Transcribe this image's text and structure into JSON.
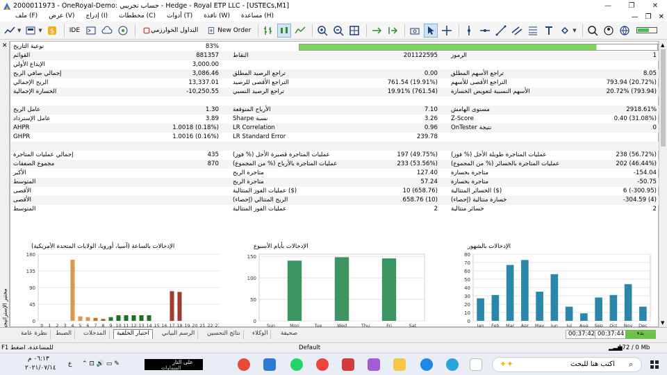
{
  "window": {
    "title": "2000011973 - OneRoyal-Demo: حساب تجريبي - Hedge - Royal ETP LLC - [USTECs,M1]"
  },
  "menu": [
    {
      "id": "file",
      "label": "ملف (F)"
    },
    {
      "id": "view",
      "label": "عرض (V)"
    },
    {
      "id": "insert",
      "label": "إدراج (I)"
    },
    {
      "id": "charts",
      "label": "مخططات (C)"
    },
    {
      "id": "tools",
      "label": "أدوات (T)"
    },
    {
      "id": "window",
      "label": "نافذة (W)"
    },
    {
      "id": "help",
      "label": "مساعدة (H)"
    }
  ],
  "toolbar": {
    "ide": "IDE",
    "algo_trading": "التداول الخوارزمي",
    "new_order": "New Order"
  },
  "report": {
    "history_quality_label": "نوعية التاريخ",
    "history_quality_value": "83%",
    "history_quality_fraction": 0.83,
    "rows": [
      {
        "a_label": "القوائم",
        "a_value": "881357",
        "b_label": "النقاط",
        "b_value": "201122595",
        "c_label": "الرموز",
        "c_value": "1"
      },
      {
        "a_label": "الإيداع الأولي",
        "a_value": "3,000.00",
        "b_label": "",
        "b_value": "",
        "c_label": "",
        "c_value": ""
      },
      {
        "a_label": "إجمالي صافي الربح",
        "a_value": "3,086.46",
        "b_label": "تراجع الرصيد المطلق",
        "b_value": "0.00",
        "c_label": "تراجع الأسهم المطلق",
        "c_value": "8.05"
      },
      {
        "a_label": "الربح الإجمالي",
        "a_value": "13,337.01",
        "b_label": "التراجع الأقصى للرصيد",
        "b_value": "761.54 (19.91%)",
        "c_label": "التراجع الأقصى للأسهم",
        "c_value": "793.94 (20.72%)"
      },
      {
        "a_label": "الخسارة الإجمالية",
        "a_value": "-10,250.55",
        "b_label": "تراجع الرصيد النسبي",
        "b_value": "19.91% (761.54)",
        "c_label": "الأسهم النسبية لتعويض الخسارة",
        "c_value": "20.72% (793.94)"
      },
      {
        "a_label": "",
        "a_value": "",
        "b_label": "",
        "b_value": "",
        "c_label": "",
        "c_value": ""
      },
      {
        "a_label": "عامل الربح",
        "a_value": "1.30",
        "b_label": "الأرباح المتوقعة",
        "b_value": "7.10",
        "c_label": "مستوى الهامش",
        "c_value": "2918.61%"
      },
      {
        "a_label": "عامل الإسترداد",
        "a_value": "3.89",
        "b_label": "Sharpe نسبة",
        "b_value": "3.26",
        "c_label": "Z-Score",
        "c_value": "0.40 (31.08%)"
      },
      {
        "a_label": "AHPR",
        "a_value": "1.0018 (0.18%)",
        "b_label": "LR Correlation",
        "b_value": "0.96",
        "c_label": "OnTester نتيجة",
        "c_value": "0"
      },
      {
        "a_label": "GHPR",
        "a_value": "1.0016 (0.16%)",
        "b_label": "LR Standard Error",
        "b_value": "239.78",
        "c_label": "",
        "c_value": ""
      },
      {
        "a_label": "",
        "a_value": "",
        "b_label": "",
        "b_value": "",
        "c_label": "",
        "c_value": ""
      },
      {
        "a_label": "إجمالي عمليات المتاجرة",
        "a_value": "435",
        "b_label": "عمليات المتاجرة قصيرة الأجل (% فوز)",
        "b_value": "197 (49.75%)",
        "c_label": "عمليات المتاجرة طويلة الأجل (% فوز)",
        "c_value": "238 (56.72%)"
      },
      {
        "a_label": "مجموع الصفقات",
        "a_value": "870",
        "b_label": "عمليات المتاجرة بالأرباح (% من المجموع)",
        "b_value": "233 (53.56%)",
        "c_label": "عمليات المتاجرة بالخسائر (% من المجموع)",
        "c_value": "202 (46.44%)"
      },
      {
        "a_label": "الأكبر",
        "a_value": "",
        "b_label": "متاجرة الربح",
        "b_value": "127.40",
        "c_label": "متاجرة بخسارة",
        "c_value": "-154.04"
      },
      {
        "a_label": "المتوسط",
        "a_value": "",
        "b_label": "متاجرة الربح",
        "b_value": "57.24",
        "c_label": "متاجرة بخسارة",
        "c_value": "-50.75"
      },
      {
        "a_label": "الأقصى",
        "a_value": "",
        "b_label": "عمليات الفوز المتتالية ($)",
        "b_value": "10 (658.76)",
        "c_label": "الخسائر المتتالية ($)",
        "c_value": "6 (-300.95)"
      },
      {
        "a_label": "الأقصى",
        "a_value": "",
        "b_label": "الربح المتتالي (إحصاء)",
        "b_value": "658.76 (10)",
        "c_label": "خسارة متتالية (إحصاء)",
        "c_value": "-304.59 (4)"
      },
      {
        "a_label": "المتوسط",
        "a_value": "",
        "b_label": "عمليات الفوز المتتالية",
        "b_value": "2",
        "c_label": "خسائر متتالية",
        "c_value": "2"
      }
    ]
  },
  "chart_data": [
    {
      "type": "bar",
      "title": "الإدخالات بالساعة (آسيا، أوروبا، الولايات المتحدة الأمريكية)",
      "categories": [
        "0",
        "1",
        "2",
        "3",
        "4",
        "5",
        "6",
        "7",
        "8",
        "9",
        "10",
        "11",
        "12",
        "13",
        "14",
        "15",
        "16",
        "17",
        "18",
        "19",
        "20",
        "21",
        "22",
        "23"
      ],
      "values": [
        0,
        0,
        0,
        0,
        165,
        12,
        10,
        8,
        5,
        10,
        15,
        15,
        15,
        15,
        15,
        0,
        0,
        80,
        78,
        0,
        0,
        0,
        0,
        0
      ],
      "colors": [
        "#d99a4e",
        "#d99a4e",
        "#d99a4e",
        "#d99a4e",
        "#d99a4e",
        "#d99a4e",
        "#d99a4e",
        "#b8791f",
        "#8a6a1a",
        "#2d7a2d",
        "#1e6e1e",
        "#1e6e1e",
        "#1e6e1e",
        "#1e6e1e",
        "#1e6e1e",
        "#1e6e1e",
        "#a23b2a",
        "#a23b2a",
        "#a23b2a",
        "#a23b2a",
        "#a23b2a",
        "#a23b2a",
        "#a23b2a",
        "#a23b2a"
      ],
      "yticks": [
        0,
        45,
        90,
        135,
        180
      ],
      "ylim": [
        0,
        180
      ]
    },
    {
      "type": "bar",
      "title": "الإدخالات بأيام الأسبوع",
      "categories": [
        "Sun",
        "Mon",
        "Tue",
        "Wed",
        "Thu",
        "Fri",
        "Sat"
      ],
      "values": [
        0,
        140,
        0,
        148,
        0,
        145,
        0
      ],
      "color": "#3c9460",
      "yticks": [
        0,
        50,
        100,
        150
      ],
      "ylim": [
        0,
        155
      ]
    },
    {
      "type": "bar",
      "title": "الإدخالات بالشهور",
      "categories": [
        "Jan",
        "Feb",
        "Mar",
        "Apr",
        "May",
        "Jun",
        "Jul",
        "Aug",
        "Sep",
        "Oct",
        "Nov",
        "Dec"
      ],
      "values": [
        27,
        31,
        67,
        73,
        35,
        56,
        17,
        9,
        28,
        31,
        44,
        17
      ],
      "color": "#2a87aa",
      "yticks": [
        0,
        10,
        20,
        30,
        40,
        50,
        60,
        70,
        80
      ],
      "ylim": [
        0,
        80
      ]
    }
  ],
  "tabs": [
    {
      "id": "overview",
      "label": "نظرة عامة"
    },
    {
      "id": "settings",
      "label": "الضبط"
    },
    {
      "id": "inputs",
      "label": "المدخلات"
    },
    {
      "id": "backtest",
      "label": "اختبار الخلفية"
    },
    {
      "id": "graph",
      "label": "الرسم البياني"
    },
    {
      "id": "optimization",
      "label": "نتائج التحسين"
    },
    {
      "id": "agents",
      "label": "الوكلاء"
    },
    {
      "id": "journal",
      "label": "صحيفة"
    }
  ],
  "timer": {
    "elapsed": "00:37:42",
    "total": "00:37:44",
    "start_label": "بدء"
  },
  "side_label": "مختبر الإستراتيجية",
  "statusbar": {
    "help": "F1 للمساعدة، اضغط",
    "profile": "Default",
    "traffic": "172 / 0 Mb"
  },
  "taskbar": {
    "search_placeholder": "اكتب هنا للبحث",
    "time": "٠٦:١٣ م",
    "date": "٢٠٢١/٠٧/١٤",
    "lang": "ع",
    "weather": "على النار",
    "weather2": "السماوات"
  }
}
